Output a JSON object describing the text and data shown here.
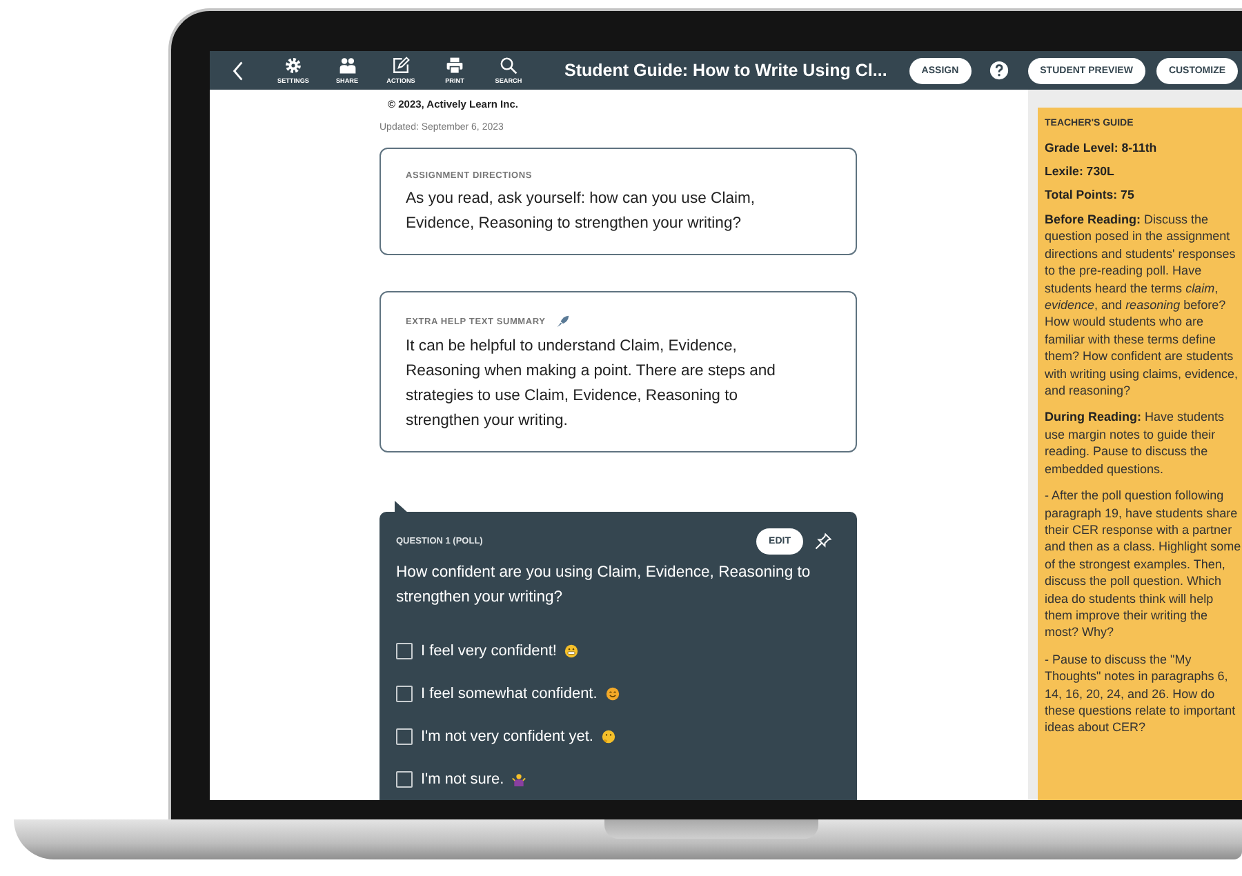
{
  "toolbar": {
    "tools": [
      {
        "kind": "settings",
        "label": "SETTINGS"
      },
      {
        "kind": "share",
        "label": "SHARE"
      },
      {
        "kind": "actions",
        "label": "ACTIONS"
      },
      {
        "kind": "print",
        "label": "PRINT"
      },
      {
        "kind": "search",
        "label": "SEARCH"
      }
    ],
    "title": "Student Guide: How to Write Using Cl...",
    "assign": "ASSIGN",
    "student_preview": "STUDENT PREVIEW",
    "customize": "CUSTOMIZE"
  },
  "copyright": "© 2023, Actively Learn Inc.",
  "updated": "Updated: September 6, 2023",
  "cards": [
    {
      "label": "ASSIGNMENT DIRECTIONS",
      "text": "As you read, ask yourself: how can you use Claim, Evidence, Reasoning to strengthen your writing?",
      "rocket": false
    },
    {
      "label": "EXTRA HELP TEXT SUMMARY",
      "text": "It can be helpful to understand Claim, Evidence, Reasoning when making a point. There are steps and strategies to use Claim, Evidence, Reasoning to strengthen your writing.",
      "rocket": true
    }
  ],
  "question": {
    "label": "QUESTION 1 (POLL)",
    "edit": "EDIT",
    "text": "How confident are you using Claim, Evidence, Reasoning to strengthen your writing?",
    "options": [
      {
        "text": "I feel very confident!",
        "checked": false,
        "kind": "grimace"
      },
      {
        "text": "I feel somewhat confident.",
        "checked": false,
        "kind": "smile"
      },
      {
        "text": "I'm not very confident yet.",
        "checked": false,
        "kind": "thinking"
      },
      {
        "text": "I'm not sure.",
        "checked": false,
        "kind": "shrug"
      }
    ]
  },
  "teachers_guide": {
    "title": "TEACHER'S GUIDE",
    "facts": [
      "Grade Level: 8-11th",
      "Lexile: 730L",
      "Total Points: 75"
    ],
    "paragraphs": [
      "**Before Reading:** Discuss the question posed in the assignment directions and students' responses to the pre-reading poll. Have students heard the terms *claim*, *evidence*, and *reasoning* before? How would students who are familiar with these terms define them? How confident are students with writing using claims, evidence, and reasoning?",
      "**During Reading:** Have students use margin notes to guide their reading. Pause to discuss the embedded questions.",
      "- After the poll question following paragraph 19, have students share their CER response with a partner and then as a class. Highlight some of the strongest examples. Then, discuss the poll question. Which idea do students think will help them improve their writing the most? Why?",
      "- Pause to discuss the \"My Thoughts\" notes in paragraphs 6, 14, 16, 20, 24, and 26. How do these questions relate to important ideas about CER?"
    ]
  }
}
